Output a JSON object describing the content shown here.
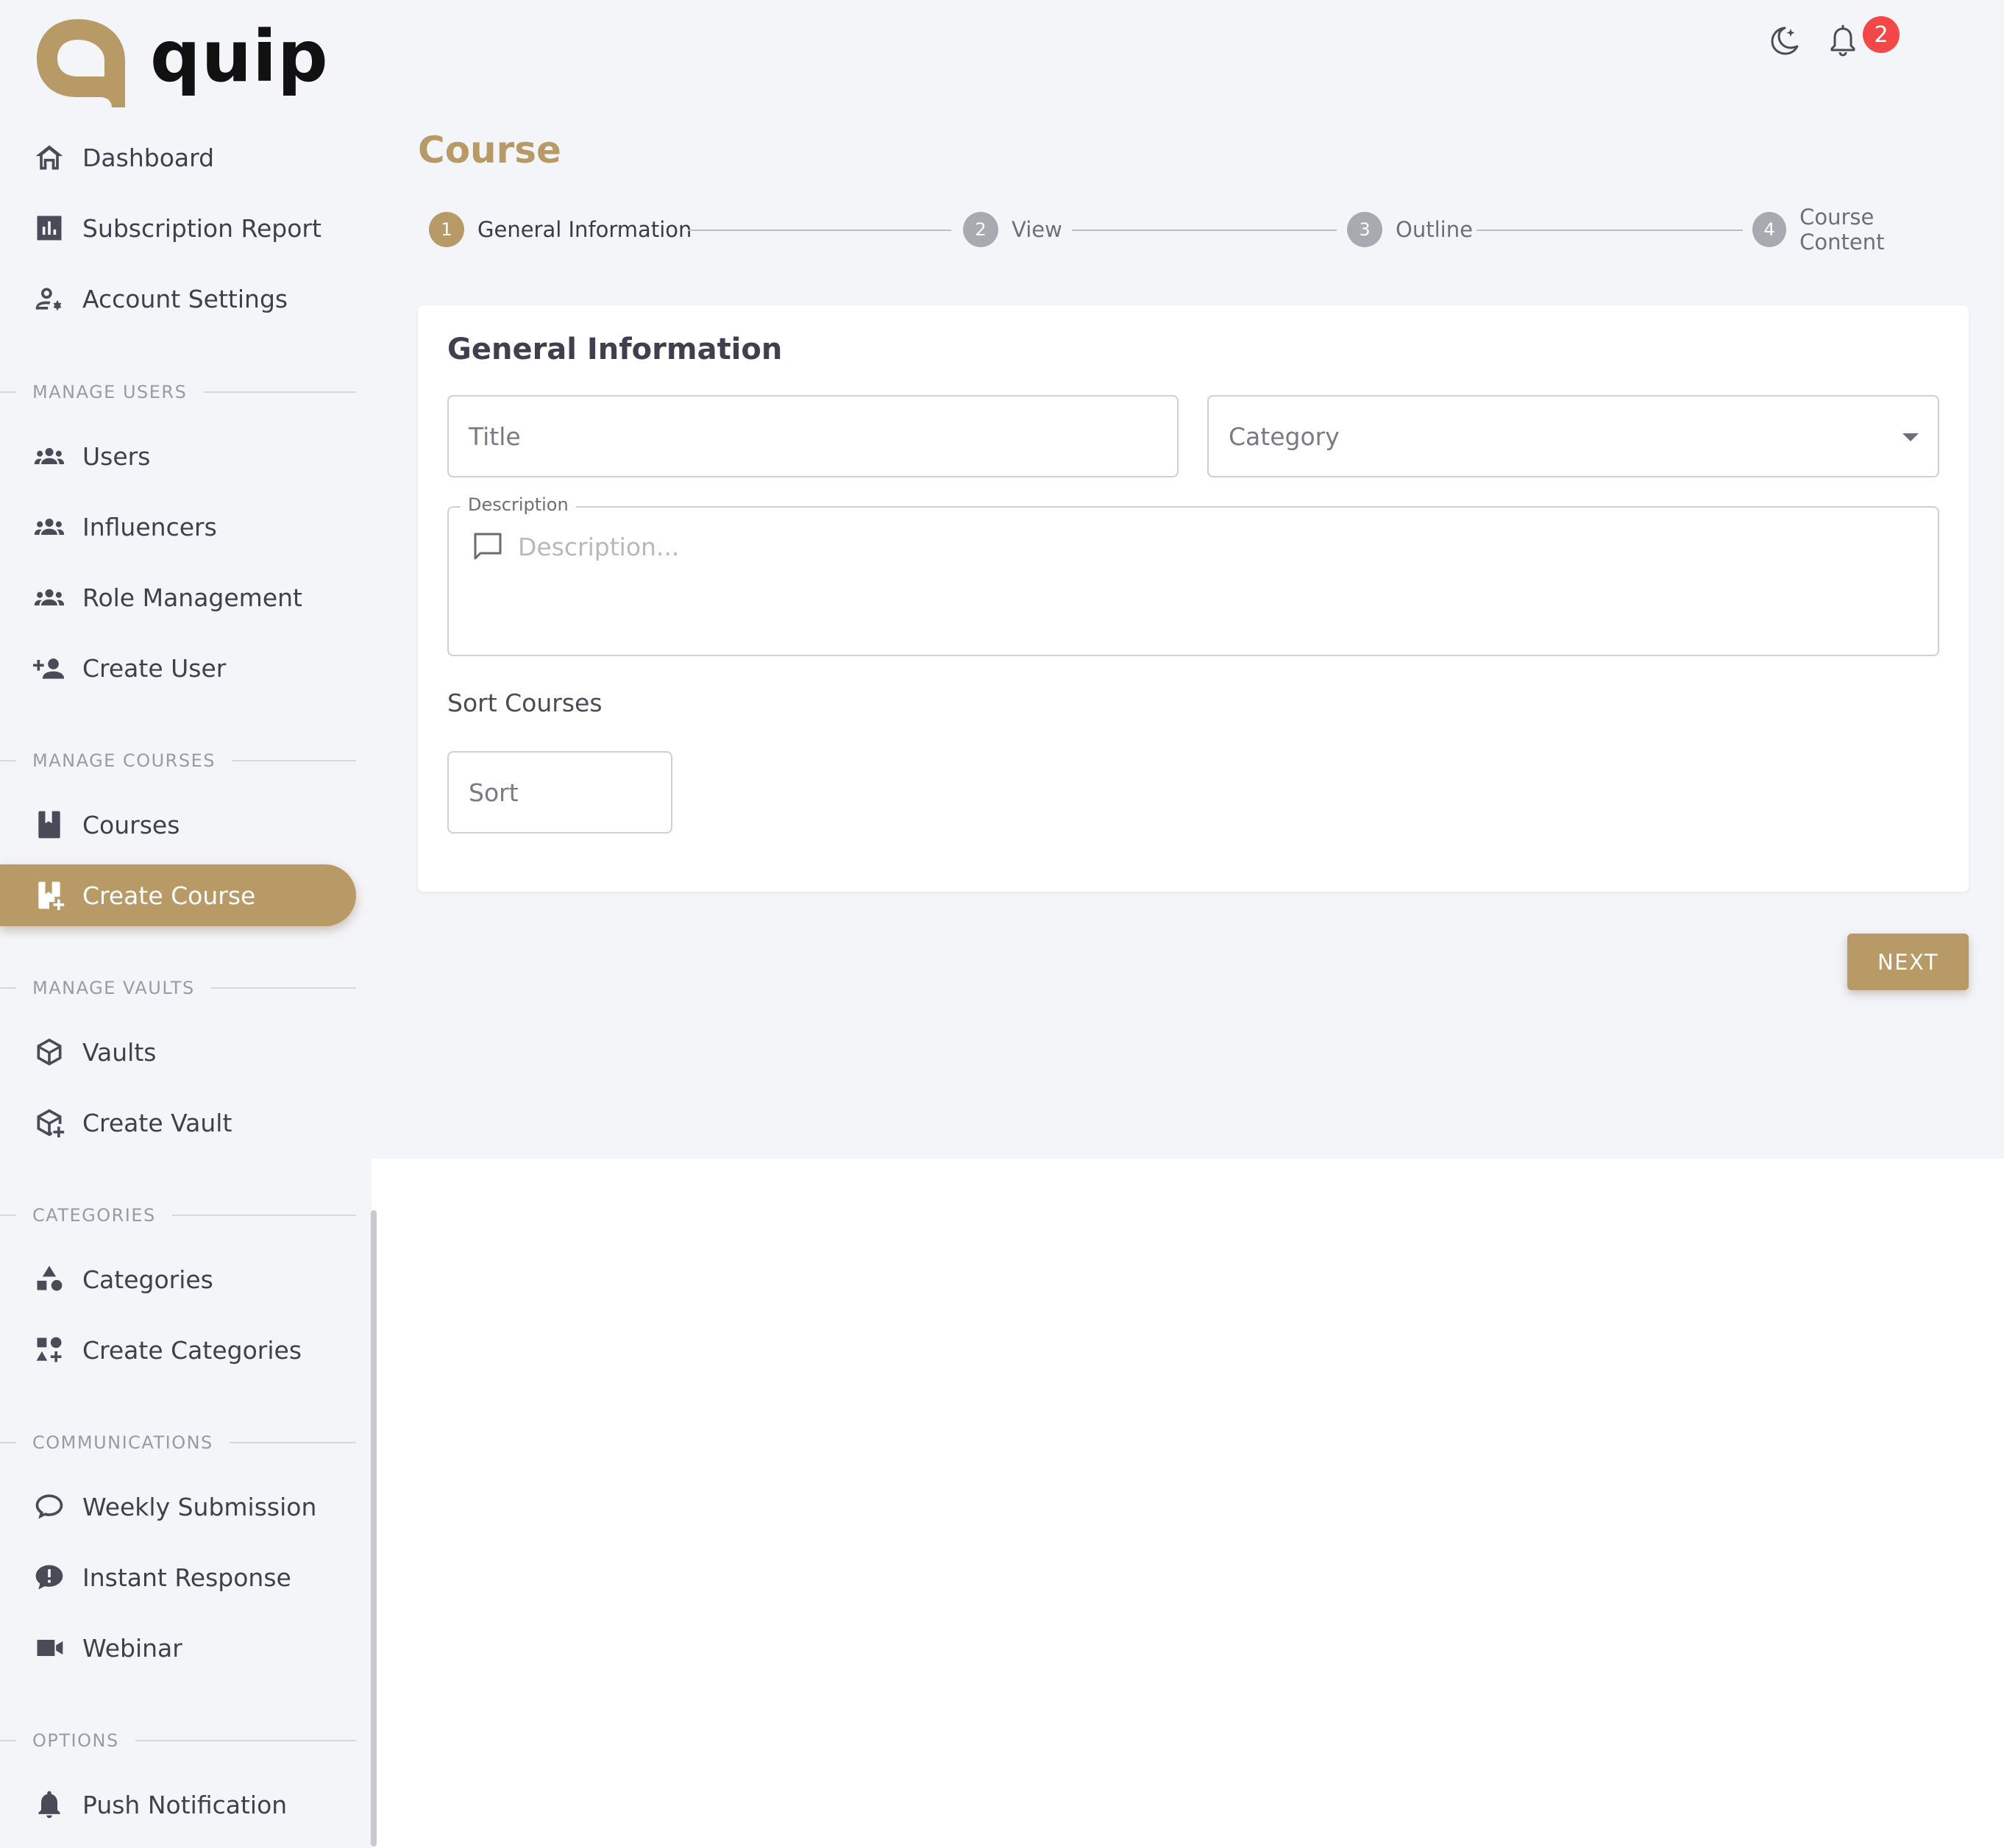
{
  "app": {
    "logo_text": "quip"
  },
  "header": {
    "notification_count": "2"
  },
  "sidebar": {
    "items_top": [
      {
        "label": "Dashboard",
        "icon": "home-icon"
      },
      {
        "label": "Subscription Report",
        "icon": "bar-chart-icon"
      },
      {
        "label": "Account Settings",
        "icon": "user-settings-icon"
      }
    ],
    "sections": {
      "manage_users": "MANAGE USERS",
      "manage_courses": "MANAGE COURSES",
      "manage_vaults": "MANAGE VAULTS",
      "categories": "CATEGORIES",
      "communications": "COMMUNICATIONS",
      "options": "OPTIONS"
    },
    "users": [
      {
        "label": "Users",
        "icon": "group-icon"
      },
      {
        "label": "Influencers",
        "icon": "group-icon"
      },
      {
        "label": "Role Management",
        "icon": "group-icon"
      },
      {
        "label": "Create User",
        "icon": "add-user-icon"
      }
    ],
    "courses": [
      {
        "label": "Courses",
        "icon": "book-icon"
      },
      {
        "label": "Create Course",
        "icon": "add-book-icon",
        "active": true
      }
    ],
    "vaults": [
      {
        "label": "Vaults",
        "icon": "cube-icon"
      },
      {
        "label": "Create Vault",
        "icon": "add-cube-icon"
      }
    ],
    "categories": [
      {
        "label": "Categories",
        "icon": "shapes-icon"
      },
      {
        "label": "Create Categories",
        "icon": "add-shapes-icon"
      }
    ],
    "communications": [
      {
        "label": "Weekly Submission",
        "icon": "chat-bubble-icon"
      },
      {
        "label": "Instant Response",
        "icon": "alert-bubble-icon"
      },
      {
        "label": "Webinar",
        "icon": "video-camera-icon"
      }
    ],
    "options": [
      {
        "label": "Push Notification",
        "icon": "bell-icon"
      }
    ]
  },
  "main": {
    "page_title": "Course",
    "steps": [
      {
        "num": "1",
        "label": "General Information"
      },
      {
        "num": "2",
        "label": "View"
      },
      {
        "num": "3",
        "label": "Outline"
      },
      {
        "num": "4",
        "label": "Course Content"
      }
    ],
    "card_title": "General Information",
    "title_placeholder": "Title",
    "category_placeholder": "Category",
    "description_label": "Description",
    "description_placeholder": "Description...",
    "sort_label": "Sort Courses",
    "sort_placeholder": "Sort",
    "next_label": "NEXT"
  },
  "colors": {
    "accent": "#b89a66",
    "badge": "#f44848",
    "background": "#f4f5f9"
  }
}
